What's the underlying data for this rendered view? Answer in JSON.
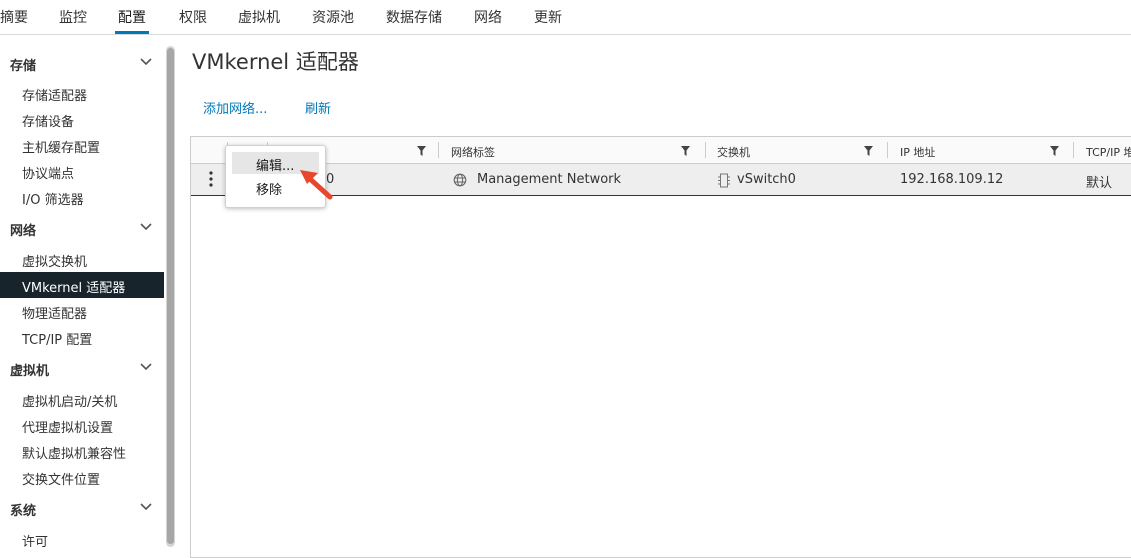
{
  "topnav": {
    "tabs": [
      {
        "label": "摘要"
      },
      {
        "label": "监控"
      },
      {
        "label": "配置",
        "active": true
      },
      {
        "label": "权限"
      },
      {
        "label": "虚拟机"
      },
      {
        "label": "资源池"
      },
      {
        "label": "数据存储"
      },
      {
        "label": "网络"
      },
      {
        "label": "更新"
      }
    ]
  },
  "sidebar": {
    "sections": [
      {
        "title": "存储",
        "items": [
          "存储适配器",
          "存储设备",
          "主机缓存配置",
          "协议端点",
          "I/O 筛选器"
        ]
      },
      {
        "title": "网络",
        "items": [
          "虚拟交换机",
          "VMkernel 适配器",
          "物理适配器",
          "TCP/IP 配置"
        ]
      },
      {
        "title": "虚拟机",
        "items": [
          "虚拟机启动/关机",
          "代理虚拟机设置",
          "默认虚拟机兼容性",
          "交换文件位置"
        ]
      },
      {
        "title": "系统",
        "items": [
          "许可"
        ]
      }
    ],
    "selected_item": "VMkernel 适配器"
  },
  "main": {
    "title": "VMkernel 适配器",
    "actions": {
      "add_network": "添加网络...",
      "refresh": "刷新"
    },
    "grid": {
      "columns": [
        "网络标签",
        "交换机",
        "IP 地址",
        "TCP/IP 堆"
      ],
      "rows": [
        {
          "device_partial": "0",
          "network_label": "Management Network",
          "switch": "vSwitch0",
          "ip": "192.168.109.12",
          "tcpip_stack": "默认"
        }
      ]
    },
    "context_menu": {
      "items": [
        "编辑...",
        "移除"
      ],
      "highlighted": "编辑..."
    }
  },
  "colors": {
    "accent": "#0079b8",
    "selected_bg": "#17242b",
    "arrow": "#e8472b"
  },
  "icons": [
    "chevron-down-icon",
    "filter-icon",
    "kebab-icon",
    "network-globe-icon",
    "switch-icon",
    "arrow-pointer-icon"
  ]
}
